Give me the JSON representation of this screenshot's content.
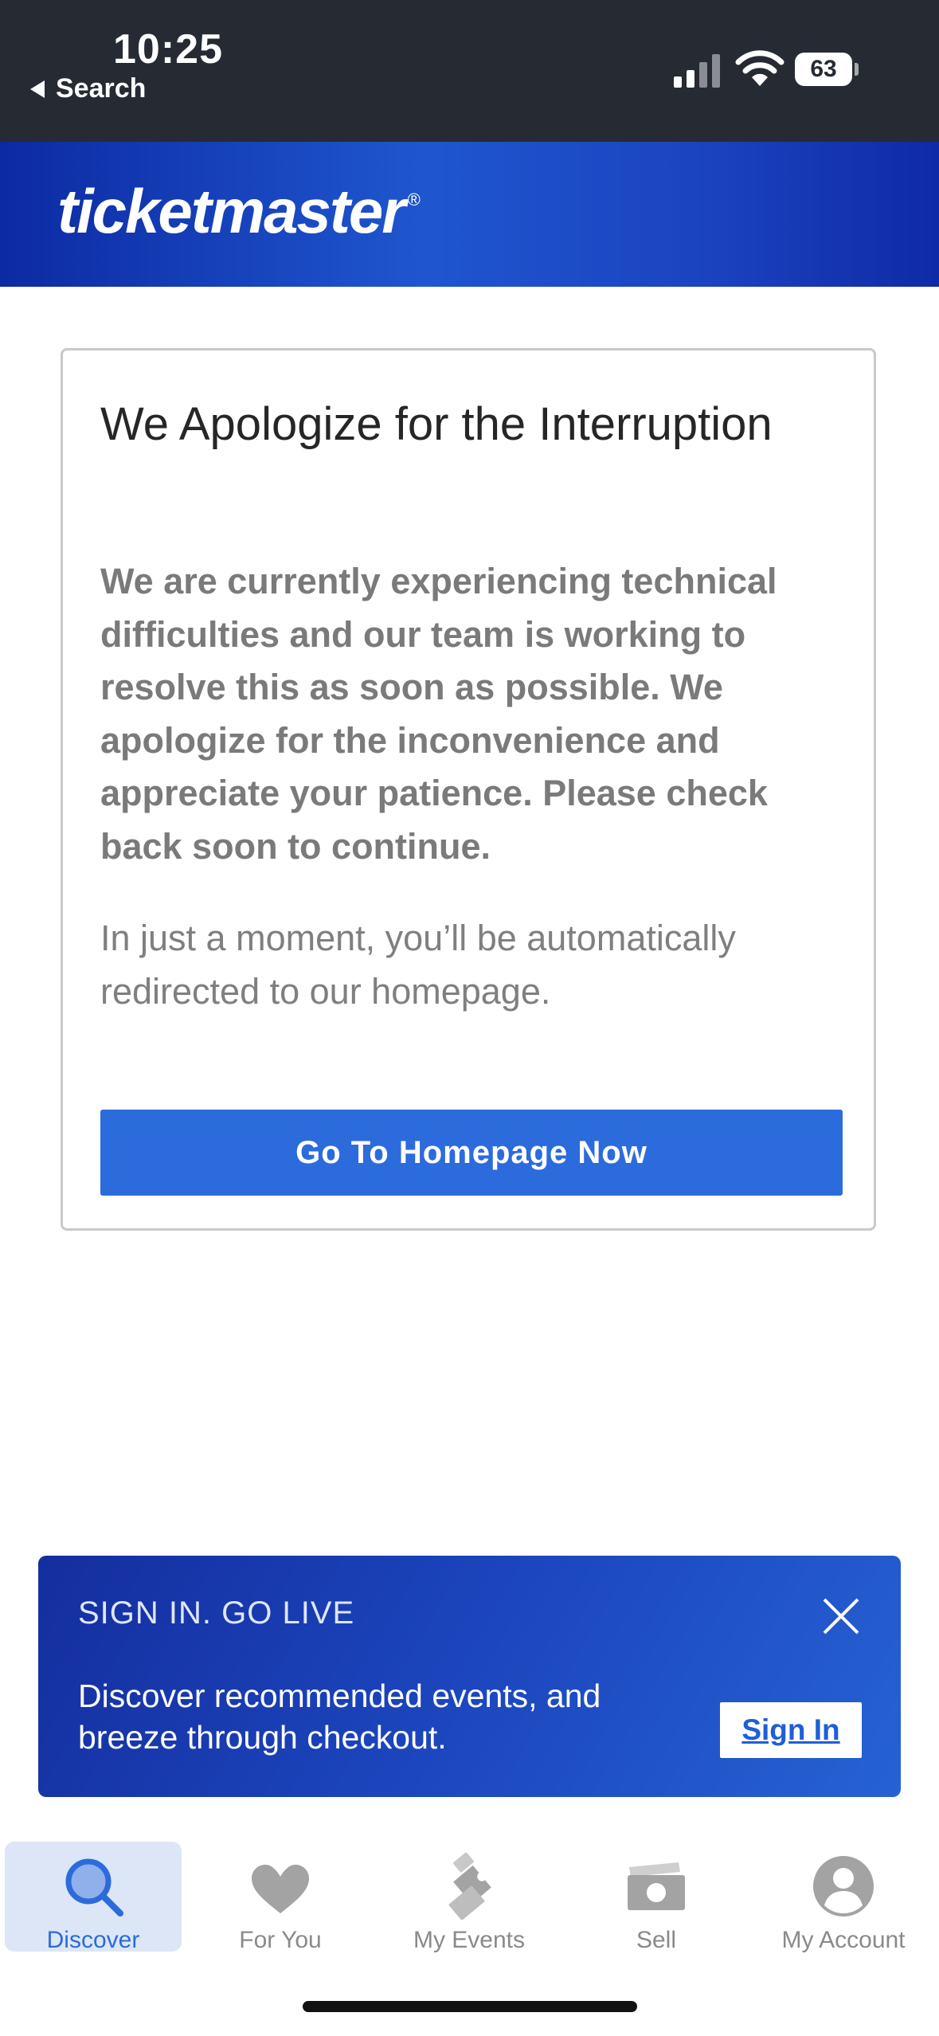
{
  "status_bar": {
    "time": "10:25",
    "back_label": "Search",
    "battery": "63"
  },
  "header": {
    "logo": "ticketmaster",
    "logo_mark": "®",
    "colors": {
      "primary": "#1f56cf",
      "dark": "#0c2aa3"
    }
  },
  "error_card": {
    "title": "We Apologize for the Interruption",
    "body": "We are currently experiencing technical difficulties and our team is working to resolve this as soon as possible. We apologize for the inconvenience and appreciate your patience. Please check back soon to continue.",
    "note": "In just a moment, you’ll be automatically redirected to our homepage.",
    "button_label": "Go To Homepage Now"
  },
  "signin_banner": {
    "title": "SIGN IN. GO LIVE",
    "text": "Discover recommended events, and breeze through checkout.",
    "signin_label": "Sign In",
    "close_icon": "close-icon"
  },
  "tabbar": {
    "items": [
      {
        "label": "Discover",
        "icon": "search-icon",
        "active": true
      },
      {
        "label": "For You",
        "icon": "heart-icon",
        "active": false
      },
      {
        "label": "My Events",
        "icon": "ticket-icon",
        "active": false
      },
      {
        "label": "Sell",
        "icon": "money-icon",
        "active": false
      },
      {
        "label": "My Account",
        "icon": "account-icon",
        "active": false
      }
    ]
  }
}
